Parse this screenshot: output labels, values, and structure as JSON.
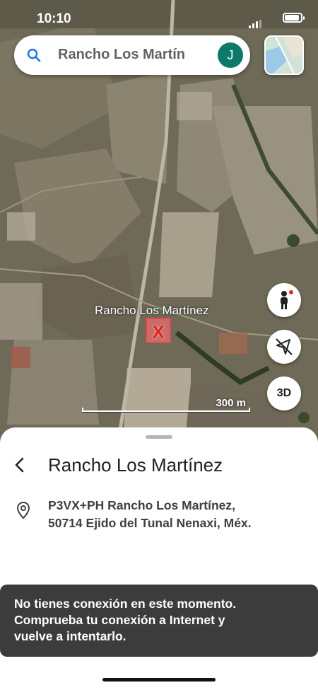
{
  "status_bar": {
    "time": "10:10"
  },
  "search": {
    "query": "Rancho Los Martín",
    "avatar_initial": "J"
  },
  "map": {
    "place_label": "Rancho Los Martínez",
    "marker_symbol": "X",
    "scale_label": "300 m",
    "three_d_label": "3D"
  },
  "place_sheet": {
    "title": "Rancho Los Martínez",
    "address_line_1": "P3VX+PH Rancho Los Martínez,",
    "address_line_2": "50714 Ejido del Tunal Nenaxi, Méx."
  },
  "snackbar": {
    "line_1": "No tienes conexión en este momento.",
    "line_2": "Comprueba tu conexión a Internet y",
    "line_3": "vuelve a intentarlo."
  },
  "colors": {
    "avatar": "#0b7a6b",
    "marker": "#e02020",
    "snackbar_bg": "#3c3c3c"
  },
  "icons": [
    "search-icon",
    "layers-icon",
    "pegman-icon",
    "compass-icon",
    "back-icon",
    "location-pin-icon"
  ]
}
